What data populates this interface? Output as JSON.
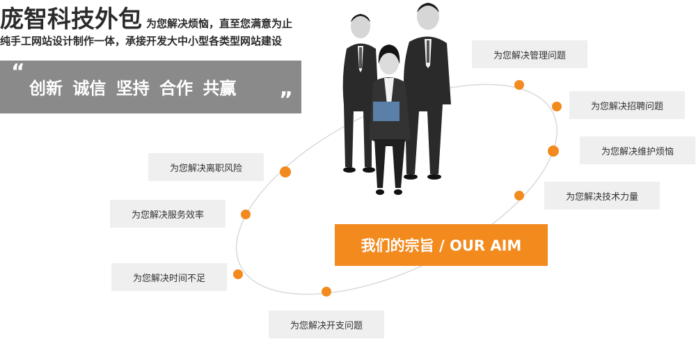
{
  "header": {
    "title": "庞智科技外包",
    "subtitle": "为您解决烦恼，直至您满意为止",
    "description": "纯手工网站设计制作一体，承接开发大中小型各类型网站建设"
  },
  "slogan": {
    "open_quote": "“",
    "text": "创新 诚信 坚持 合作 共赢",
    "close_quote": "”"
  },
  "aim": {
    "label": "我们的宗旨 / OUR AIM"
  },
  "labels": {
    "management": "为您解决管理问题",
    "recruiting": "为您解决招聘问题",
    "maintenance": "为您解决维护烦恼",
    "tech_power": "为您解决技术力量",
    "resignation": "为您解决离职风险",
    "service_efficiency": "为您解决服务效率",
    "time_shortage": "为您解决时间不足",
    "development": "为您解决开支问题"
  },
  "colors": {
    "accent": "#f28a1e",
    "banner_gray": "#8a8a8a",
    "label_bg": "#efefef",
    "text_dark": "#2b2b2b"
  }
}
